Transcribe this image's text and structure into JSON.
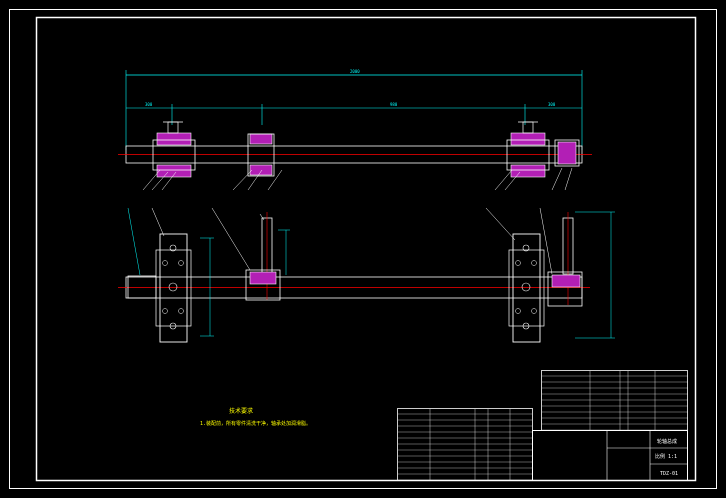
{
  "title_block": {
    "name_cell": "轮轴总成",
    "scale_cell": "比例 1:1",
    "drawing_no": "TDZ-01"
  },
  "notes": {
    "title": "技术要求",
    "body": "1.装配前，所有零件清洗干净，轴承处加润滑脂。"
  },
  "dimensions": {
    "overall": "2000",
    "left_seg": "300",
    "mid_seg": "980",
    "right_seg": "300"
  },
  "colors": {
    "outline": "#ffffff",
    "dimension": "#00ffff",
    "centerline": "#ff0000",
    "hatch": "#b21fb5",
    "text": "#ffff00"
  }
}
